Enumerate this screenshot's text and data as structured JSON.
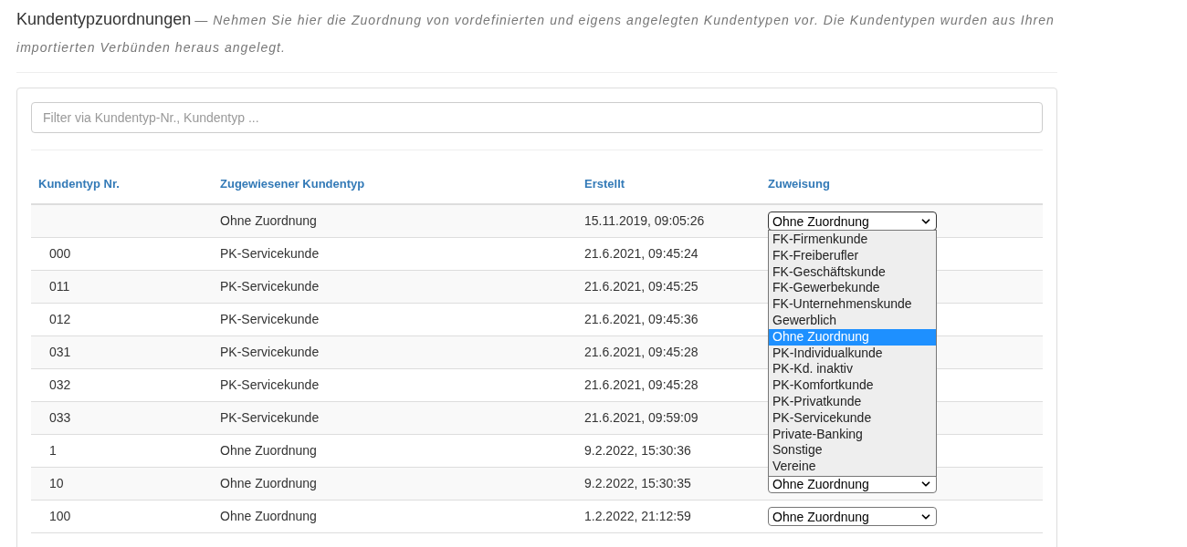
{
  "header": {
    "title": "Kundentypzuordnungen",
    "description": "— Nehmen Sie hier die Zuordnung von vordefinierten und eigens angelegten Kundentypen vor. Die Kundentypen wurden aus Ihren importierten Verbünden heraus angelegt."
  },
  "filter": {
    "placeholder": "Filter via Kundentyp-Nr., Kundentyp ..."
  },
  "table": {
    "columns": [
      "Kundentyp Nr.",
      "Zugewiesener Kundentyp",
      "Erstellt",
      "Zuweisung"
    ],
    "rows": [
      {
        "number": "",
        "type": "Ohne Zuordnung",
        "created": "15.11.2019, 09:05:26",
        "assignment": {
          "value": "Ohne Zuordnung",
          "expanded": true,
          "options": [
            {
              "label": "FK-Firmenkunde",
              "selected": false
            },
            {
              "label": "FK-Freiberufler",
              "selected": false
            },
            {
              "label": "FK-Geschäftskunde",
              "selected": false
            },
            {
              "label": "FK-Gewerbekunde",
              "selected": false
            },
            {
              "label": "FK-Unternehmenskunde",
              "selected": false
            },
            {
              "label": "Gewerblich",
              "selected": false
            },
            {
              "label": "Ohne Zuordnung",
              "selected": true
            },
            {
              "label": "PK-Individualkunde",
              "selected": false
            },
            {
              "label": "PK-Kd. inaktiv",
              "selected": false
            },
            {
              "label": "PK-Komfortkunde",
              "selected": false
            },
            {
              "label": "PK-Privatkunde",
              "selected": false
            },
            {
              "label": "PK-Servicekunde",
              "selected": false
            },
            {
              "label": "Private-Banking",
              "selected": false
            },
            {
              "label": "Sonstige",
              "selected": false
            },
            {
              "label": "Vereine",
              "selected": false
            }
          ]
        }
      },
      {
        "number": "000",
        "type": "PK-Servicekunde",
        "created": "21.6.2021, 09:45:24"
      },
      {
        "number": "011",
        "type": "PK-Servicekunde",
        "created": "21.6.2021, 09:45:25"
      },
      {
        "number": "012",
        "type": "PK-Servicekunde",
        "created": "21.6.2021, 09:45:36"
      },
      {
        "number": "031",
        "type": "PK-Servicekunde",
        "created": "21.6.2021, 09:45:28"
      },
      {
        "number": "032",
        "type": "PK-Servicekunde",
        "created": "21.6.2021, 09:45:28"
      },
      {
        "number": "033",
        "type": "PK-Servicekunde",
        "created": "21.6.2021, 09:59:09"
      },
      {
        "number": "1",
        "type": "Ohne Zuordnung",
        "created": "9.2.2022, 15:30:36"
      },
      {
        "number": "10",
        "type": "Ohne Zuordnung",
        "created": "9.2.2022, 15:30:35",
        "assignment": {
          "value": "Ohne Zuordnung",
          "expanded": false
        }
      },
      {
        "number": "100",
        "type": "Ohne Zuordnung",
        "created": "1.2.2022, 21:12:59",
        "assignment": {
          "value": "Ohne Zuordnung",
          "expanded": false
        }
      }
    ]
  }
}
